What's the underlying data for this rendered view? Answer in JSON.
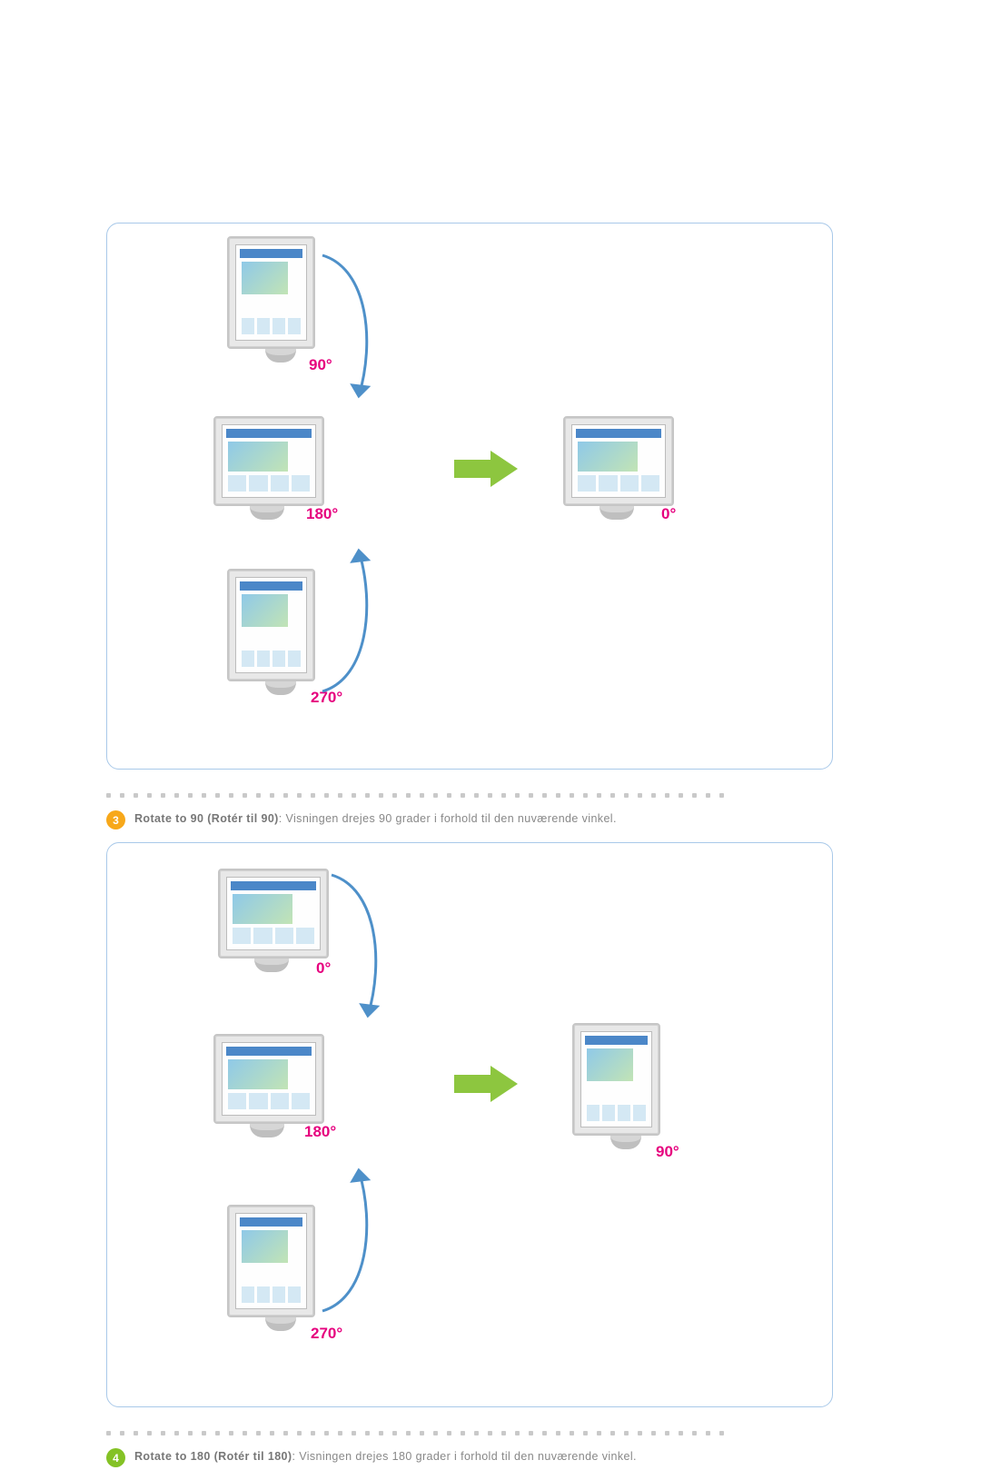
{
  "steps": {
    "s3": {
      "number": "3",
      "title_en": "Rotate to 90",
      "title_local": "(Rotér til 90)",
      "desc": ": Visningen drejes 90 grader i forhold til den nuværende vinkel."
    },
    "s4": {
      "number": "4",
      "title_en": "Rotate to 180",
      "title_local": "(Rotér til 180)",
      "desc": ": Visningen drejes 180 grader i forhold til den nuværende vinkel."
    }
  },
  "angles": {
    "a0": "0°",
    "a90": "90°",
    "a180": "180°",
    "a270": "270°"
  }
}
